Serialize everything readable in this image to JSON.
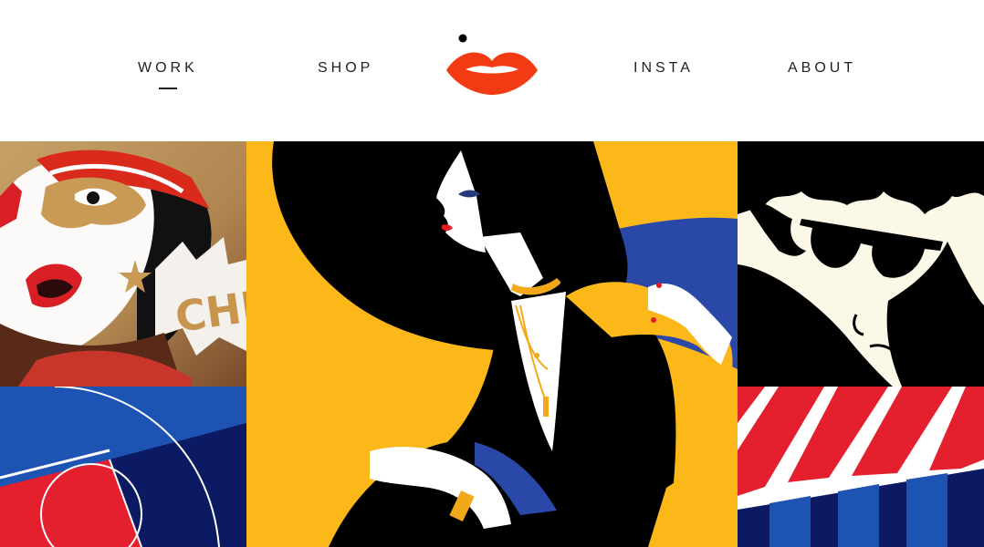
{
  "nav": {
    "items": [
      {
        "label": "WORK",
        "active": true
      },
      {
        "label": "SHOP",
        "active": false
      },
      {
        "label": "INSTA",
        "active": false
      },
      {
        "label": "ABOUT",
        "active": false
      }
    ]
  },
  "logo": {
    "icon": "lips-logo-icon",
    "color": "#f23b12"
  },
  "gallery": {
    "tiles": [
      {
        "name": "artwork-pop-girl",
        "caption": "CHI"
      },
      {
        "name": "artwork-woman-big-hat"
      },
      {
        "name": "artwork-man-sunglasses"
      },
      {
        "name": "artwork-court-lines"
      },
      {
        "name": "artwork-striped-awning"
      }
    ]
  },
  "colors": {
    "accent": "#f23b12",
    "yellow": "#fbb818",
    "blue": "#1d3d9e",
    "red": "#e5202e",
    "navy": "#0c1a63"
  }
}
